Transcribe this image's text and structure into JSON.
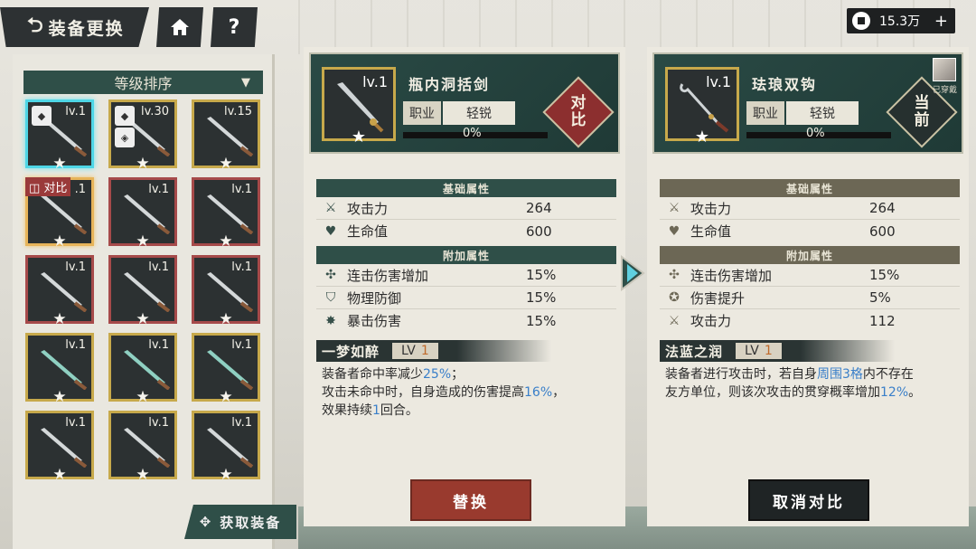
{
  "header": {
    "title": "装备更换",
    "home_icon": "home-icon",
    "help_label": "?"
  },
  "currency": {
    "amount": "15.3万",
    "plus": "+"
  },
  "list": {
    "sort_label": "等级排序",
    "compare_tag": "对比",
    "get_button": "获取装备",
    "items": [
      {
        "lv": "lv.1",
        "style": "selected",
        "color": "#c7a94b"
      },
      {
        "lv": "lv.30",
        "style": "gold",
        "color": "#c7a94b"
      },
      {
        "lv": "lv.15",
        "style": "gold",
        "color": "#c7a94b"
      },
      {
        "lv": ".1",
        "style": "compare",
        "color": "#c7a94b"
      },
      {
        "lv": "lv.1",
        "style": "red",
        "color": "#a64a4a"
      },
      {
        "lv": "lv.1",
        "style": "red",
        "color": "#a64a4a"
      },
      {
        "lv": "lv.1",
        "style": "red",
        "color": "#a64a4a"
      },
      {
        "lv": "lv.1",
        "style": "red",
        "color": "#a64a4a"
      },
      {
        "lv": "lv.1",
        "style": "red",
        "color": "#a64a4a"
      },
      {
        "lv": "lv.1",
        "style": "gold",
        "color": "#c7a94b"
      },
      {
        "lv": "lv.1",
        "style": "gold",
        "color": "#c7a94b"
      },
      {
        "lv": "lv.1",
        "style": "gold",
        "color": "#c7a94b"
      },
      {
        "lv": "lv.1",
        "style": "gold",
        "color": "#c7a94b"
      },
      {
        "lv": "lv.1",
        "style": "gold",
        "color": "#c7a94b"
      },
      {
        "lv": "lv.1",
        "style": "gold",
        "color": "#c7a94b"
      }
    ]
  },
  "left_card": {
    "name": "瓶内洞括剑",
    "lv": "lv.1",
    "class_key": "职业",
    "class_val": "轻锐",
    "progress": "0%",
    "badge": "对比",
    "base_title": "基础属性",
    "base": [
      {
        "icon": "swords-icon",
        "name": "攻击力",
        "value": "264"
      },
      {
        "icon": "heart-icon",
        "name": "生命值",
        "value": "600"
      }
    ],
    "extra_title": "附加属性",
    "extra": [
      {
        "icon": "combo-icon",
        "name": "连击伤害增加",
        "value": "15%"
      },
      {
        "icon": "shield-icon",
        "name": "物理防御",
        "value": "15%"
      },
      {
        "icon": "crit-icon",
        "name": "暴击伤害",
        "value": "15%"
      }
    ],
    "skill_name": "一梦如醉",
    "skill_lv_label": "LV",
    "skill_lv": "1",
    "skill_desc_1": "装备者命中率减少",
    "skill_hl_1": "25%",
    "skill_desc_2": "；",
    "skill_desc_3": "攻击未命中时，自身造成的伤害提高",
    "skill_hl_2": "16%",
    "skill_desc_4": "，",
    "skill_desc_5": "效果持续",
    "skill_hl_3": "1",
    "skill_desc_6": "回合。",
    "button": "替换"
  },
  "right_card": {
    "name": "珐琅双钩",
    "lv": "lv.1",
    "class_key": "职业",
    "class_val": "轻锐",
    "progress": "0%",
    "badge": "当前",
    "worn_label": "已穿戴",
    "base_title": "基础属性",
    "base": [
      {
        "icon": "swords-icon",
        "name": "攻击力",
        "value": "264"
      },
      {
        "icon": "heart-icon",
        "name": "生命值",
        "value": "600"
      }
    ],
    "extra_title": "附加属性",
    "extra": [
      {
        "icon": "combo-icon",
        "name": "连击伤害增加",
        "value": "15%"
      },
      {
        "icon": "damage-up-icon",
        "name": "伤害提升",
        "value": "5%"
      },
      {
        "icon": "swords-icon",
        "name": "攻击力",
        "value": "112"
      }
    ],
    "skill_name": "法蓝之润",
    "skill_lv_label": "LV",
    "skill_lv": "1",
    "skill_desc_1": "装备者进行攻击时，若自身",
    "skill_hl_1": "周围3格",
    "skill_desc_2": "内不存在",
    "skill_desc_3": "友方单位，则该次攻击的贯穿概率增加",
    "skill_hl_2": "12%",
    "skill_desc_4": "。",
    "button": "取消对比"
  }
}
